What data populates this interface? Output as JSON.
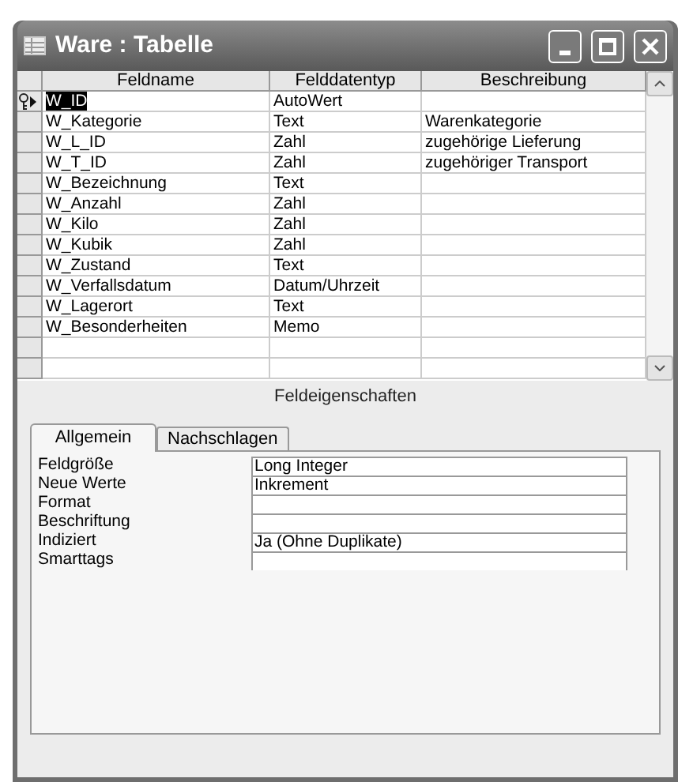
{
  "window": {
    "title": "Ware : Tabelle"
  },
  "table": {
    "columns": [
      "Feldname",
      "Felddatentyp",
      "Beschreibung"
    ],
    "rows": [
      {
        "name": "W_ID",
        "type": "AutoWert",
        "selected": true,
        "primary_key": true
      },
      {
        "name": "W_Kategorie",
        "type": "Text",
        "description": "Warenkategorie",
        "selected": false,
        "primary_key": false
      },
      {
        "name": "W_L_ID",
        "type": "Zahl",
        "description": "zugehörige Lieferung",
        "selected": false,
        "primary_key": false
      },
      {
        "name": "W_T_ID",
        "type": "Zahl",
        "description": "zugehöriger Transport",
        "selected": false,
        "primary_key": false
      },
      {
        "name": "W_Bezeichnung",
        "type": "Text",
        "selected": false,
        "primary_key": false
      },
      {
        "name": "W_Anzahl",
        "type": "Zahl",
        "selected": false,
        "primary_key": false
      },
      {
        "name": "W_Kilo",
        "type": "Zahl",
        "selected": false,
        "primary_key": false
      },
      {
        "name": "W_Kubik",
        "type": "Zahl",
        "selected": false,
        "primary_key": false
      },
      {
        "name": "W_Zustand",
        "type": "Text",
        "selected": false,
        "primary_key": false
      },
      {
        "name": "W_Verfallsdatum",
        "type": "Datum/Uhrzeit",
        "selected": false,
        "primary_key": false
      },
      {
        "name": "W_Lagerort",
        "type": "Text",
        "selected": false,
        "primary_key": false
      },
      {
        "name": "W_Besonderheiten",
        "type": "Memo",
        "selected": false,
        "primary_key": false
      }
    ]
  },
  "section_title": "Feldeigenschaften",
  "tabs": [
    {
      "label": "Allgemein",
      "selected": true
    },
    {
      "label": "Nachschlagen",
      "selected": false
    }
  ],
  "properties": [
    {
      "label": "Feldgröße",
      "value": "Long Integer"
    },
    {
      "label": "Neue Werte",
      "value": "Inkrement"
    },
    {
      "label": "Format"
    },
    {
      "label": "Beschriftung"
    },
    {
      "label": "Indiziert",
      "value": "Ja (Ohne Duplikate)"
    },
    {
      "label": "Smarttags"
    }
  ]
}
